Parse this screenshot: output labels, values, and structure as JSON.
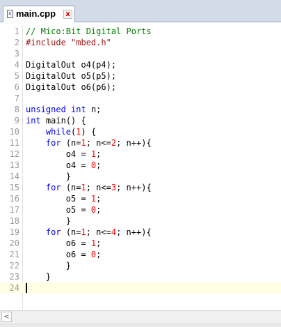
{
  "tab": {
    "icon_glyph": "c",
    "label": "main.cpp",
    "close_glyph": "x"
  },
  "scrollbar": {
    "left_arrow": "<"
  },
  "colors": {
    "comment": "#008000",
    "directive": "#a31515",
    "keyword": "#0000ff",
    "number": "#ff0000",
    "line_number": "#999999",
    "current_line_highlight": "#ffffe6"
  },
  "current_line": 24,
  "code_lines": [
    {
      "n": "1",
      "tokens": [
        {
          "t": "// Mico:Bit Digital Ports",
          "c": "comment"
        }
      ]
    },
    {
      "n": "2",
      "tokens": [
        {
          "t": "#include \"mbed.h\"",
          "c": "directive"
        }
      ]
    },
    {
      "n": "3",
      "tokens": []
    },
    {
      "n": "4",
      "tokens": [
        {
          "t": "DigitalOut o4(p4);",
          "c": "plain"
        }
      ]
    },
    {
      "n": "5",
      "tokens": [
        {
          "t": "DigitalOut o5(p5);",
          "c": "plain"
        }
      ]
    },
    {
      "n": "6",
      "tokens": [
        {
          "t": "DigitalOut o6(p6);",
          "c": "plain"
        }
      ]
    },
    {
      "n": "7",
      "tokens": []
    },
    {
      "n": "8",
      "tokens": [
        {
          "t": "unsigned",
          "c": "keyword"
        },
        {
          "t": " ",
          "c": "plain"
        },
        {
          "t": "int",
          "c": "keyword"
        },
        {
          "t": " n;",
          "c": "plain"
        }
      ]
    },
    {
      "n": "9",
      "tokens": [
        {
          "t": "int",
          "c": "keyword"
        },
        {
          "t": " main() {",
          "c": "plain"
        }
      ]
    },
    {
      "n": "10",
      "tokens": [
        {
          "t": "    ",
          "c": "plain"
        },
        {
          "t": "while",
          "c": "keyword"
        },
        {
          "t": "(",
          "c": "plain"
        },
        {
          "t": "1",
          "c": "number"
        },
        {
          "t": ") {",
          "c": "plain"
        }
      ]
    },
    {
      "n": "11",
      "tokens": [
        {
          "t": "    ",
          "c": "plain"
        },
        {
          "t": "for",
          "c": "keyword"
        },
        {
          "t": " (n=",
          "c": "plain"
        },
        {
          "t": "1",
          "c": "number"
        },
        {
          "t": "; n<=",
          "c": "plain"
        },
        {
          "t": "2",
          "c": "number"
        },
        {
          "t": "; n++){",
          "c": "plain"
        }
      ]
    },
    {
      "n": "12",
      "tokens": [
        {
          "t": "        o4 = ",
          "c": "plain"
        },
        {
          "t": "1",
          "c": "number"
        },
        {
          "t": ";",
          "c": "plain"
        }
      ]
    },
    {
      "n": "13",
      "tokens": [
        {
          "t": "        o4 = ",
          "c": "plain"
        },
        {
          "t": "0",
          "c": "number"
        },
        {
          "t": ";",
          "c": "plain"
        }
      ]
    },
    {
      "n": "14",
      "tokens": [
        {
          "t": "        }",
          "c": "plain"
        }
      ]
    },
    {
      "n": "15",
      "tokens": [
        {
          "t": "    ",
          "c": "plain"
        },
        {
          "t": "for",
          "c": "keyword"
        },
        {
          "t": " (n=",
          "c": "plain"
        },
        {
          "t": "1",
          "c": "number"
        },
        {
          "t": "; n<=",
          "c": "plain"
        },
        {
          "t": "3",
          "c": "number"
        },
        {
          "t": "; n++){",
          "c": "plain"
        }
      ]
    },
    {
      "n": "16",
      "tokens": [
        {
          "t": "        o5 = ",
          "c": "plain"
        },
        {
          "t": "1",
          "c": "number"
        },
        {
          "t": ";",
          "c": "plain"
        }
      ]
    },
    {
      "n": "17",
      "tokens": [
        {
          "t": "        o5 = ",
          "c": "plain"
        },
        {
          "t": "0",
          "c": "number"
        },
        {
          "t": ";",
          "c": "plain"
        }
      ]
    },
    {
      "n": "18",
      "tokens": [
        {
          "t": "        }",
          "c": "plain"
        }
      ]
    },
    {
      "n": "19",
      "tokens": [
        {
          "t": "    ",
          "c": "plain"
        },
        {
          "t": "for",
          "c": "keyword"
        },
        {
          "t": " (n=",
          "c": "plain"
        },
        {
          "t": "1",
          "c": "number"
        },
        {
          "t": "; n<=",
          "c": "plain"
        },
        {
          "t": "4",
          "c": "number"
        },
        {
          "t": "; n++){",
          "c": "plain"
        }
      ]
    },
    {
      "n": "20",
      "tokens": [
        {
          "t": "        o6 = ",
          "c": "plain"
        },
        {
          "t": "1",
          "c": "number"
        },
        {
          "t": ";",
          "c": "plain"
        }
      ]
    },
    {
      "n": "21",
      "tokens": [
        {
          "t": "        o6 = ",
          "c": "plain"
        },
        {
          "t": "0",
          "c": "number"
        },
        {
          "t": ";",
          "c": "plain"
        }
      ]
    },
    {
      "n": "22",
      "tokens": [
        {
          "t": "        }",
          "c": "plain"
        }
      ]
    },
    {
      "n": "23",
      "tokens": [
        {
          "t": "    }",
          "c": "plain"
        }
      ]
    },
    {
      "n": "24",
      "tokens": []
    }
  ]
}
